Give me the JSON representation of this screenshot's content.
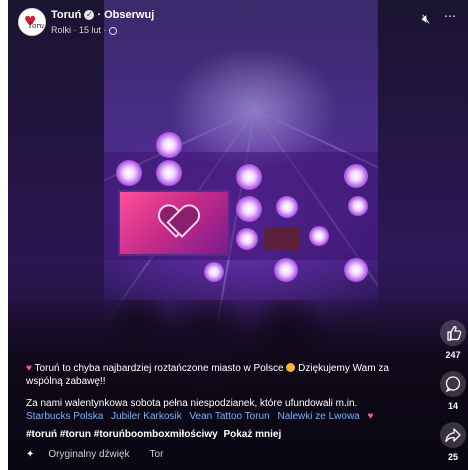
{
  "header": {
    "page_name": "Toruń",
    "verified_glyph": "✓",
    "separator": " · ",
    "follow_label": "Obserwuj",
    "meta": "Rolki · 15 lut ·",
    "avatar_text": "Toruń"
  },
  "controls": {
    "mute_icon": "speaker-muted-icon",
    "more_icon": "more-dots-icon"
  },
  "rail": {
    "likes": "247",
    "comments": "14",
    "shares": "25"
  },
  "caption": {
    "line1": "Toruń to chyba najbardziej roztańczone miasto w Polsce",
    "line1_tail": "Dziękujemy Wam za wspólną zabawę!!",
    "line2": "Za nami walentynkowa sobota pełna niespodzianek, które ufundowali m.in.",
    "sponsors": [
      "Starbucks Polska",
      "Jubiler Karkosik",
      "Vean Tattoo Torun",
      "Nalewki ze Lwowa"
    ],
    "hashtags": "#toruń #torun #toruńboomboxmiłościwy",
    "show_more": "Pokaż mniej"
  },
  "audio": {
    "label": "Oryginalny dźwięk",
    "tail": "Tor"
  },
  "colors": {
    "link": "#6fb4ff",
    "background": "#1b1033",
    "heart": "#ff5a86"
  }
}
